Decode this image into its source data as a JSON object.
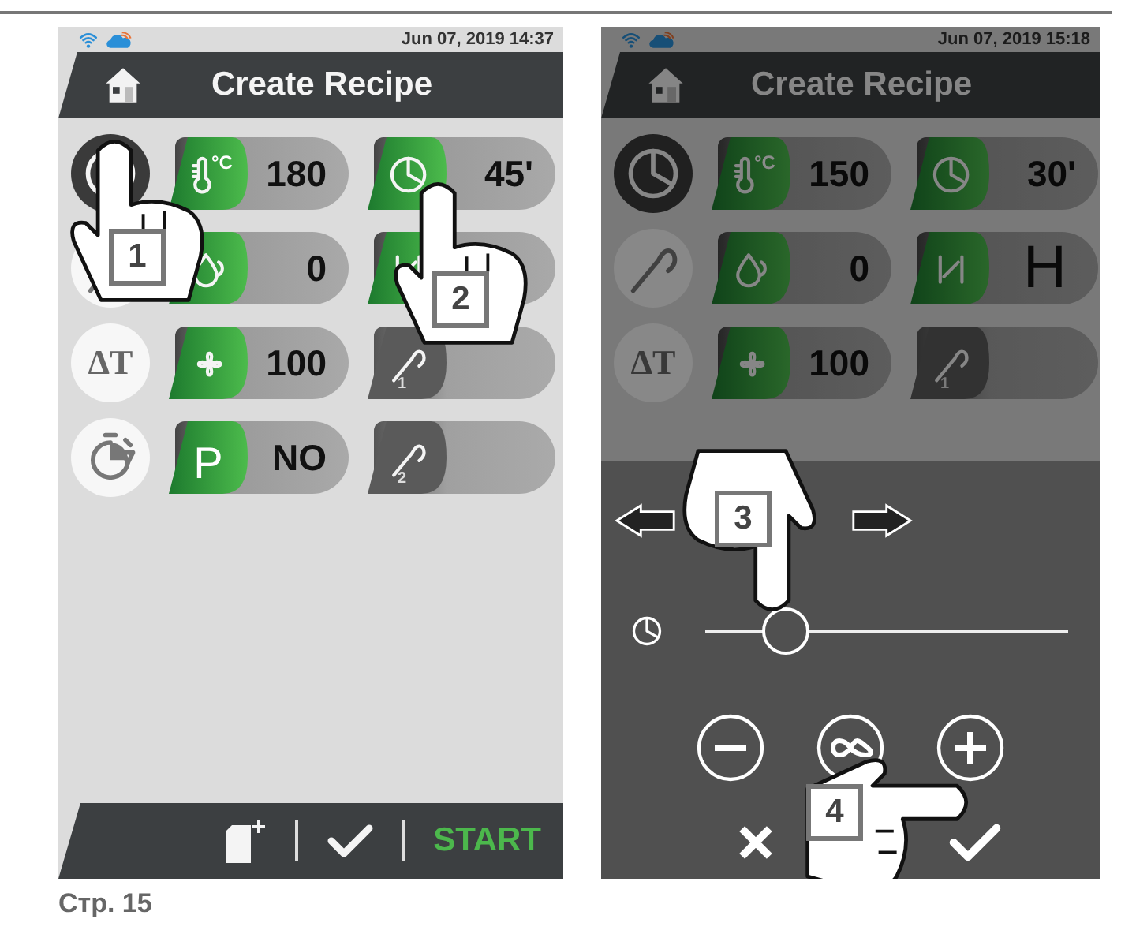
{
  "screens": [
    {
      "dimmed": false,
      "date": "Jun 07, 2019  14:37",
      "title": "Create Recipe",
      "side_buttons": [
        {
          "kind": "clock",
          "selected": true
        },
        {
          "kind": "probe",
          "selected": false
        },
        {
          "kind": "delta",
          "label": "ΔT",
          "selected": false
        },
        {
          "kind": "timer",
          "selected": false
        }
      ],
      "tiles": [
        {
          "kind": "thermometer",
          "badge_text": "°C",
          "value": "180",
          "enabled": true
        },
        {
          "kind": "clock",
          "value": "45'",
          "enabled": true
        },
        {
          "kind": "humidity",
          "value": "0",
          "enabled": true
        },
        {
          "kind": "fan_speed",
          "enabled": true
        },
        {
          "kind": "fan",
          "value": "100",
          "enabled": true
        },
        {
          "kind": "probe",
          "badge_text": "1",
          "enabled": false
        },
        {
          "kind": "letter",
          "badge_text": "P",
          "value": "NO",
          "enabled": true
        },
        {
          "kind": "probe",
          "badge_text": "2",
          "enabled": false
        }
      ],
      "bottom_bar": {
        "action": "START"
      },
      "hands": [
        {
          "kind": "tap",
          "number": "1"
        },
        {
          "kind": "tap",
          "number": "2"
        }
      ]
    },
    {
      "dimmed": true,
      "date": "Jun 07, 2019  15:18",
      "title": "Create Recipe",
      "side_buttons": [
        {
          "kind": "clock",
          "selected": true
        },
        {
          "kind": "probe",
          "selected": false
        },
        {
          "kind": "delta",
          "label": "ΔT",
          "selected": false
        }
      ],
      "tiles": [
        {
          "kind": "thermometer",
          "badge_text": "°C",
          "value": "150",
          "enabled": true
        },
        {
          "kind": "clock",
          "value": "30'",
          "enabled": true
        },
        {
          "kind": "humidity",
          "value": "0",
          "enabled": true
        },
        {
          "kind": "fan_speed",
          "value": "H",
          "enabled": true
        },
        {
          "kind": "fan",
          "value": "100",
          "enabled": true
        },
        {
          "kind": "probe",
          "badge_text": "1",
          "enabled": false
        }
      ],
      "panel": {
        "slider": {
          "level": 0.22
        }
      },
      "hands": [
        {
          "kind": "swipe",
          "number": "3"
        },
        {
          "kind": "point",
          "number": "4"
        }
      ]
    }
  ],
  "page_label": "Стр. 15"
}
